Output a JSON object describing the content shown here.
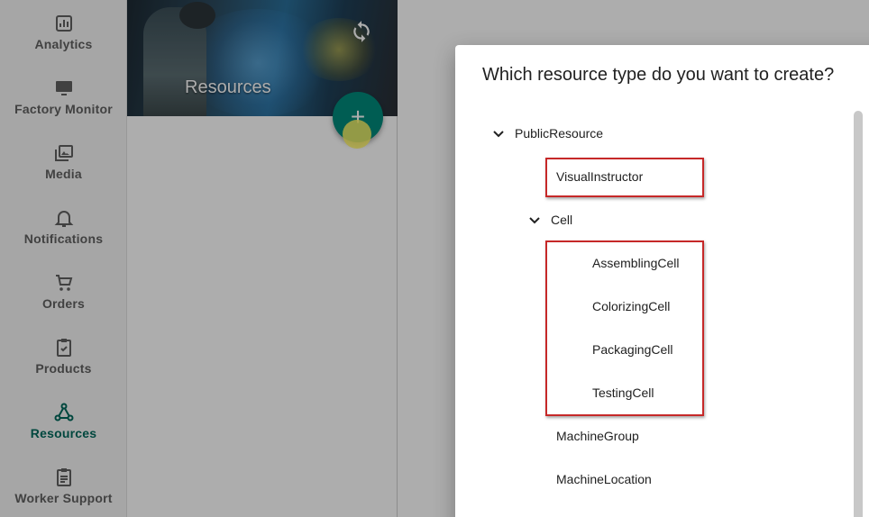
{
  "sidebar": {
    "items": [
      {
        "label": "Analytics",
        "icon": "analytics-icon"
      },
      {
        "label": "Factory Monitor",
        "icon": "monitor-icon"
      },
      {
        "label": "Media",
        "icon": "media-icon"
      },
      {
        "label": "Notifications",
        "icon": "bell-icon"
      },
      {
        "label": "Orders",
        "icon": "cart-icon"
      },
      {
        "label": "Products",
        "icon": "clipboard-check-icon"
      },
      {
        "label": "Resources",
        "icon": "hub-icon"
      },
      {
        "label": "Worker Support",
        "icon": "clipboard-list-icon"
      }
    ],
    "active": "Resources",
    "active_color": "#00695c"
  },
  "panel": {
    "title": "Resources",
    "add_button": "+"
  },
  "dialog": {
    "title": "Which resource type do you want to create?",
    "tree": {
      "root": "PublicResource",
      "visual_instructor": "VisualInstructor",
      "cell": "Cell",
      "cell_children": [
        "AssemblingCell",
        "ColorizingCell",
        "PackagingCell",
        "TestingCell"
      ],
      "machine_group": "MachineGroup",
      "machine_location": "MachineLocation"
    }
  },
  "colors": {
    "accent": "#00897b",
    "highlight": "#c62828"
  }
}
